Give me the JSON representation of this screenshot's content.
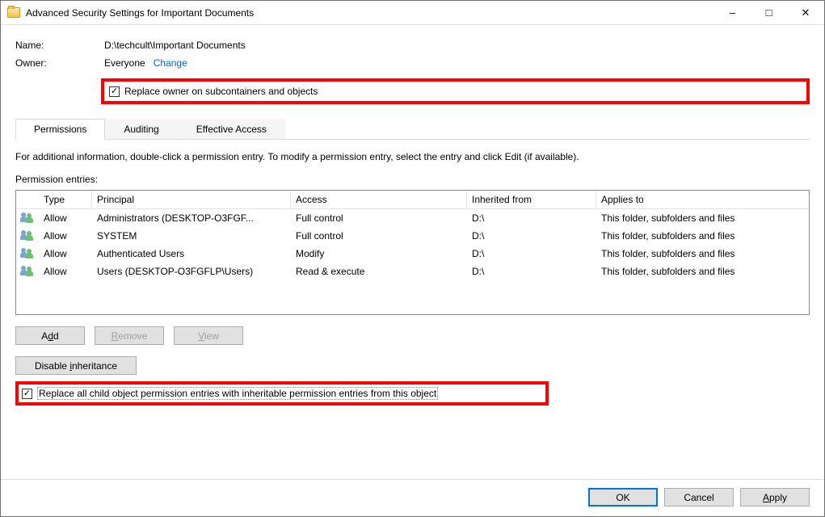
{
  "window": {
    "title": "Advanced Security Settings for Important Documents"
  },
  "info": {
    "name_label": "Name:",
    "name_value": "D:\\techcult\\Important Documents",
    "owner_label": "Owner:",
    "owner_value": "Everyone",
    "change_link": "Change",
    "replace_owner_label": "Replace owner on subcontainers and objects"
  },
  "tabs": {
    "permissions": "Permissions",
    "auditing": "Auditing",
    "effective": "Effective Access"
  },
  "main": {
    "instruction": "For additional information, double-click a permission entry. To modify a permission entry, select the entry and click Edit (if available).",
    "entries_label": "Permission entries:",
    "headers": {
      "type": "Type",
      "principal": "Principal",
      "access": "Access",
      "inherited": "Inherited from",
      "applies": "Applies to"
    },
    "rows": [
      {
        "type": "Allow",
        "principal": "Administrators (DESKTOP-O3FGF...",
        "access": "Full control",
        "inherited": "D:\\",
        "applies": "This folder, subfolders and files"
      },
      {
        "type": "Allow",
        "principal": "SYSTEM",
        "access": "Full control",
        "inherited": "D:\\",
        "applies": "This folder, subfolders and files"
      },
      {
        "type": "Allow",
        "principal": "Authenticated Users",
        "access": "Modify",
        "inherited": "D:\\",
        "applies": "This folder, subfolders and files"
      },
      {
        "type": "Allow",
        "principal": "Users (DESKTOP-O3FGFLP\\Users)",
        "access": "Read & execute",
        "inherited": "D:\\",
        "applies": "This folder, subfolders and files"
      }
    ],
    "buttons": {
      "add_pre": "A",
      "add_u": "d",
      "add_post": "d",
      "remove_pre": "",
      "remove_u": "R",
      "remove_post": "emove",
      "view_pre": "",
      "view_u": "V",
      "view_post": "iew",
      "disable_pre": "Disable ",
      "disable_u": "i",
      "disable_post": "nheritance"
    },
    "replace_children_label": "Replace all child object permission entries with inheritable permission entries from this object"
  },
  "footer": {
    "ok": "OK",
    "cancel": "Cancel",
    "apply_pre": "",
    "apply_u": "A",
    "apply_post": "pply"
  }
}
